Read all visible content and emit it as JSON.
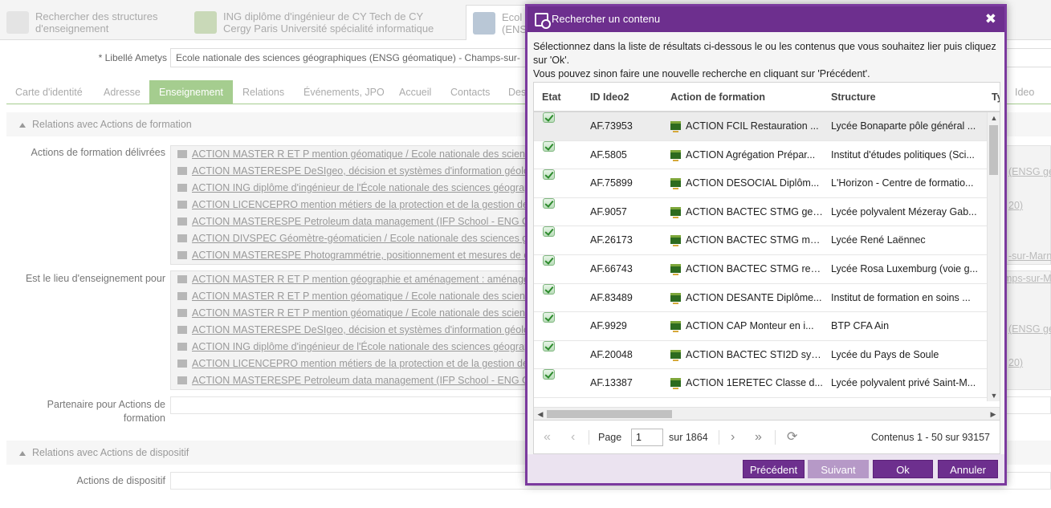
{
  "background": {
    "tabs": [
      {
        "line1": "Rechercher des structures",
        "line2": "d'enseignement"
      },
      {
        "line1": "ING diplôme d'ingénieur de CY Tech de CY",
        "line2": "Cergy Paris Université spécialité informatique"
      },
      {
        "line1": "Ecol",
        "line2": "(ENS"
      }
    ],
    "libelle_label": "* Libellé Ametys",
    "libelle_value": "Ecole nationale des sciences géographiques (ENSG géomatique) - Champs-sur-",
    "nav_tabs": [
      "Carte d'identité",
      "Adresse",
      "Enseignement",
      "Relations",
      "Événements, JPO",
      "Accueil",
      "Contacts",
      "Des",
      "Ideo"
    ],
    "section1": "Relations avec Actions de formation",
    "field1_label": "Actions de formation délivrées",
    "field1_items": [
      "ACTION MASTER R ET P mention géomatique / Ecole nationale des sciences",
      "ACTION MASTERESPE DeSIgeo, décision et systèmes d'information géoloca",
      "ACTION ING diplôme d'ingénieur de l'École nationale des sciences géograp",
      "ACTION LICENCEPRO mention métiers de la protection et de la gestion de l",
      "ACTION MASTERESPE Petroleum data management (IFP School - ENG Géom",
      "ACTION DIVSPEC Géomètre-géomaticien / Ecole nationale des sciences géo",
      "ACTION MASTERESPE Photogrammétrie, positionnement et mesures de dé"
    ],
    "field2_label": "Est le lieu d'enseignement pour",
    "field2_items": [
      "ACTION MASTER R ET P mention géographie et aménagement : aménagem",
      "ACTION MASTER R ET P mention géomatique / Ecole nationale des science",
      "ACTION MASTER R ET P mention géomatique / Ecole nationale des science",
      "ACTION MASTERESPE DeSIgeo, décision et systèmes d'information géoloca",
      "ACTION ING diplôme d'ingénieur de l'École nationale des sciences géograp",
      "ACTION LICENCEPRO mention métiers de la protection et de la gestion de l",
      "ACTION MASTERESPE Petroleum data management (IFP School - ENG Géon"
    ],
    "side_texts": [
      "(ENSG gé",
      "20)",
      "-sur-Marn",
      "mps-sur-Ma",
      "(ENSG gé",
      "20)"
    ],
    "field3_label_1": "Partenaire pour Actions de",
    "field3_label_2": "formation",
    "section2": "Relations avec Actions de dispositif",
    "field4_label": "Actions de dispositif"
  },
  "modal": {
    "title": "Rechercher un contenu",
    "close": "✖",
    "intro_1": "Sélectionnez dans la liste de résultats ci-dessous le ou les contenus que vous souhaitez lier puis cliquez sur 'Ok'.",
    "intro_2": "Vous pouvez sinon faire une nouvelle recherche en cliquant sur 'Précédent'.",
    "columns": [
      "Etat",
      "ID Ideo2",
      "Action de formation",
      "Structure",
      "Ty"
    ],
    "rows": [
      {
        "id": "AF.73953",
        "action": "ACTION FCIL Restauration ...",
        "structure": "Lycée Bonaparte pôle général ..."
      },
      {
        "id": "AF.5805",
        "action": "ACTION Agrégation Prépar...",
        "structure": "Institut d'études politiques (Sci..."
      },
      {
        "id": "AF.75899",
        "action": "ACTION DESOCIAL Diplôm...",
        "structure": "L'Horizon - Centre de formatio..."
      },
      {
        "id": "AF.9057",
        "action": "ACTION BACTEC STMG ges...",
        "structure": "Lycée polyvalent Mézeray Gab..."
      },
      {
        "id": "AF.26173",
        "action": "ACTION BACTEC STMG ma...",
        "structure": "Lycée René Laënnec"
      },
      {
        "id": "AF.66743",
        "action": "ACTION BACTEC STMG res...",
        "structure": "Lycée Rosa Luxemburg (voie g..."
      },
      {
        "id": "AF.83489",
        "action": "ACTION DESANTE Diplôme...",
        "structure": "Institut de formation en soins ..."
      },
      {
        "id": "AF.9929",
        "action": "ACTION CAP Monteur en i...",
        "structure": "BTP CFA Ain"
      },
      {
        "id": "AF.20048",
        "action": "ACTION BACTEC STI2D sys...",
        "structure": "Lycée du Pays de Soule"
      },
      {
        "id": "AF.13387",
        "action": "ACTION 1ERETEC Classe d...",
        "structure": "Lycée polyvalent privé Saint-M..."
      }
    ],
    "pager": {
      "page_label": "Page",
      "page_value": "1",
      "of_label": "sur 1864",
      "summary": "Contenus 1 - 50 sur 93157"
    },
    "buttons": {
      "previous": "Précédent",
      "next": "Suivant",
      "ok": "Ok",
      "cancel": "Annuler"
    },
    "colors": {
      "accent": "#6d2f8e",
      "disabled": "#b699c7",
      "nav_active": "#a5cd8f"
    }
  }
}
